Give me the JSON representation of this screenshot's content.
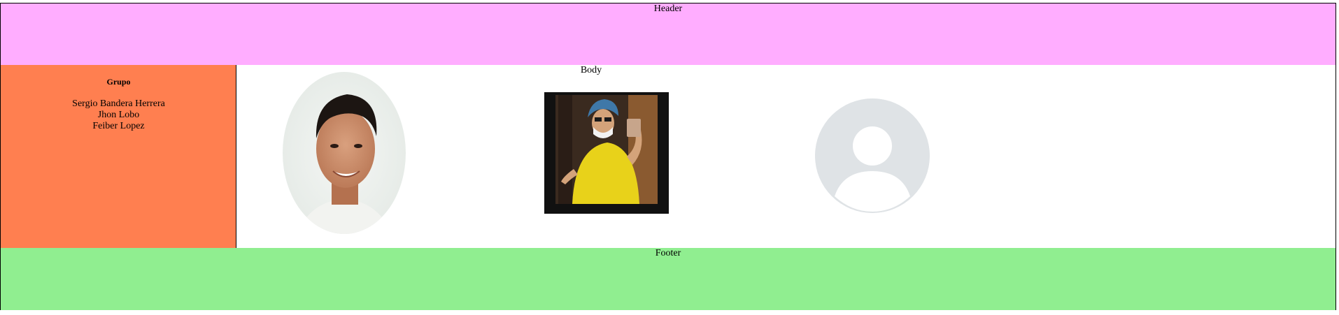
{
  "header": {
    "label": "Header"
  },
  "sidebar": {
    "heading": "Grupo",
    "members": [
      "Sergio Bandera Herrera",
      "Jhon Lobo",
      "Feiber Lopez"
    ]
  },
  "main": {
    "label": "Body",
    "photos": [
      {
        "icon": "person-oval-photo"
      },
      {
        "icon": "cyclist-selfie-photo"
      },
      {
        "icon": "default-avatar-icon"
      }
    ]
  },
  "footer": {
    "label": "Footer"
  },
  "colors": {
    "header": "#ffadff",
    "sidebar": "#ff7f50",
    "footer": "#90ee90"
  }
}
